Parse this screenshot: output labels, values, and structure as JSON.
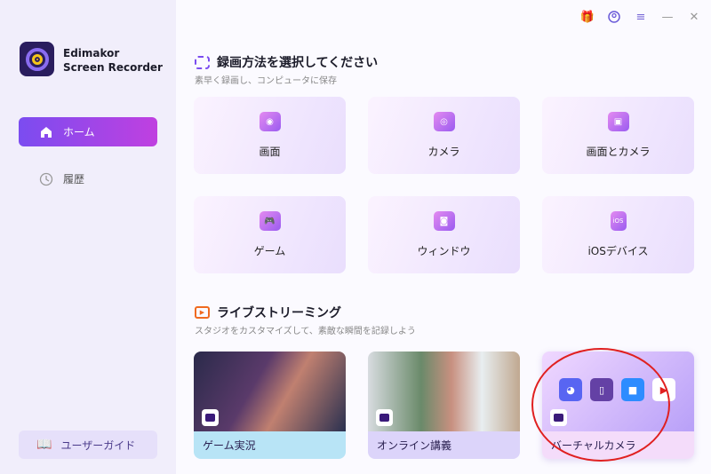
{
  "app": {
    "name_line1": "Edimakor",
    "name_line2": "Screen Recorder"
  },
  "sidebar": {
    "items": [
      {
        "label": "ホーム",
        "icon": "home-icon"
      },
      {
        "label": "履歴",
        "icon": "clock-icon"
      }
    ],
    "guide": "ユーザーガイド"
  },
  "topbar": {
    "icons": [
      "gift-icon",
      "account-icon",
      "menu-icon",
      "minimize-icon",
      "close-icon"
    ]
  },
  "record": {
    "title": "録画方法を選択してください",
    "subtitle": "素早く録画し、コンピュータに保存",
    "cards": [
      {
        "label": "画面"
      },
      {
        "label": "カメラ"
      },
      {
        "label": "画面とカメラ"
      },
      {
        "label": "ゲーム"
      },
      {
        "label": "ウィンドウ"
      },
      {
        "label": "iOSデバイス"
      }
    ]
  },
  "live": {
    "title": "ライブストリーミング",
    "subtitle": "スタジオをカスタマイズして、素敵な瞬間を記録しよう",
    "cards": [
      {
        "label": "ゲーム実況"
      },
      {
        "label": "オンライン講義"
      },
      {
        "label": "バーチャルカメラ"
      }
    ]
  },
  "colors": {
    "accent": "#7b4cf0",
    "annotation": "#e02020"
  }
}
